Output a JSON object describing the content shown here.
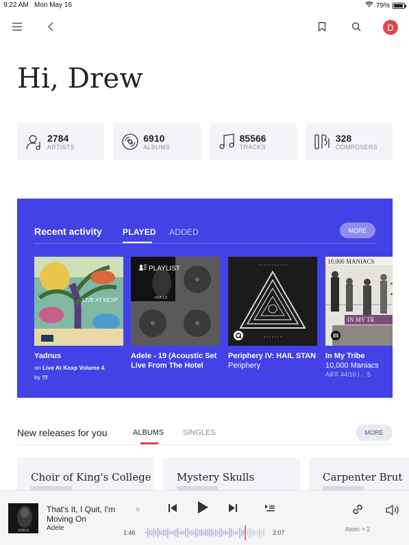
{
  "status_bar": {
    "time": "9:22 AM",
    "date": "Mon May 16",
    "battery": "79%",
    "battery_level": 0.79
  },
  "header": {
    "avatar_initial": "D"
  },
  "greeting": "Hi, Drew",
  "stats": [
    {
      "value": "2784",
      "label": "ARTISTS",
      "icon": "artist-icon"
    },
    {
      "value": "6910",
      "label": "ALBUMS",
      "icon": "album-icon"
    },
    {
      "value": "85566",
      "label": "TRACKS",
      "icon": "music-note-icon"
    },
    {
      "value": "328",
      "label": "COMPOSERS",
      "icon": "composer-icon"
    }
  ],
  "recent": {
    "title": "Recent activity",
    "tabs": [
      "PLAYED",
      "ADDED"
    ],
    "active_tab": "PLAYED",
    "more_label": "MORE",
    "accent_color": "#4242e6",
    "items": [
      {
        "title": "Yadnus",
        "on_prefix": "on",
        "album": "Live At Kexp Volume 4",
        "by_prefix": "by",
        "artist": "!!!",
        "art_text": "LIVE AT KEXP"
      },
      {
        "title": "Adele - 19 (Acoustic Set Live From The Hotel",
        "badge": "PLAYLIST",
        "art_text": "ADELE"
      },
      {
        "title": "Periphery IV: HAIL STAN",
        "subtitle": "Periphery"
      },
      {
        "title": "In My Tribe",
        "subtitle": "10,000 Maniacs",
        "meta": "AIFF 44/16 | ♩5",
        "art_text": "10,000 MANIACS",
        "art_text_2": "IN MY TR"
      }
    ]
  },
  "new_releases": {
    "title": "New releases for you",
    "tabs": [
      "ALBUMS",
      "SINGLES"
    ],
    "active_tab": "ALBUMS",
    "more_label": "MORE",
    "items": [
      "Choir of King's College",
      "Mystery Skulls",
      "Carpenter Brut"
    ]
  },
  "player": {
    "track": "That's It, I Quit, I'm Moving On",
    "artist": "Adele",
    "elapsed": "1:46",
    "duration": "2:07",
    "progress": 0.83,
    "device": "Atom + 2",
    "thumb_text": "ADELE"
  }
}
